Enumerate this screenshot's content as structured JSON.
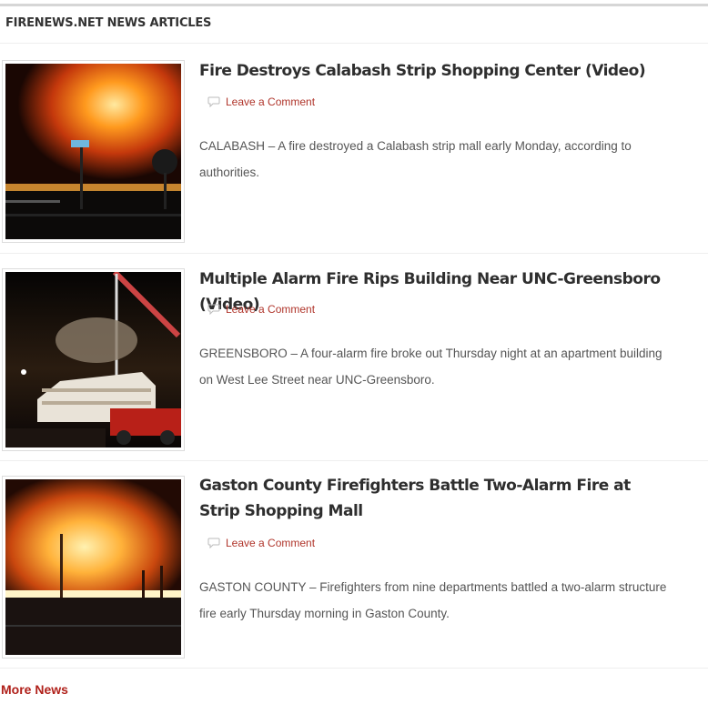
{
  "section": {
    "title": "FIRENEWS.NET NEWS ARTICLES"
  },
  "articles": [
    {
      "headline": "Fire Destroys Calabash Strip Shopping Center (Video)",
      "comment_label": "Leave a Comment",
      "excerpt": "CALABASH – A fire destroyed a Calabash strip mall early Monday, according to authorities."
    },
    {
      "headline": "Multiple Alarm Fire Rips Building Near UNC-Greensboro (Video)",
      "comment_label": "Leave a Comment",
      "excerpt": "GREENSBORO – A four-alarm fire broke out Thursday night at an apartment building on West Lee Street near UNC-Greensboro."
    },
    {
      "headline": "Gaston County Firefighters Battle Two-Alarm Fire at Strip Shopping Mall",
      "comment_label": "Leave a Comment",
      "excerpt": "GASTON COUNTY – Firefighters from nine departments battled a two-alarm structure fire early Thursday morning in Gaston County."
    }
  ],
  "footer": {
    "more_label": "More News"
  },
  "colors": {
    "link": "#b0352b",
    "more": "#b0201a",
    "headline": "#2e2e2e",
    "fire": "#f08a1c"
  },
  "icons": [
    "comment-bubble-icon"
  ]
}
